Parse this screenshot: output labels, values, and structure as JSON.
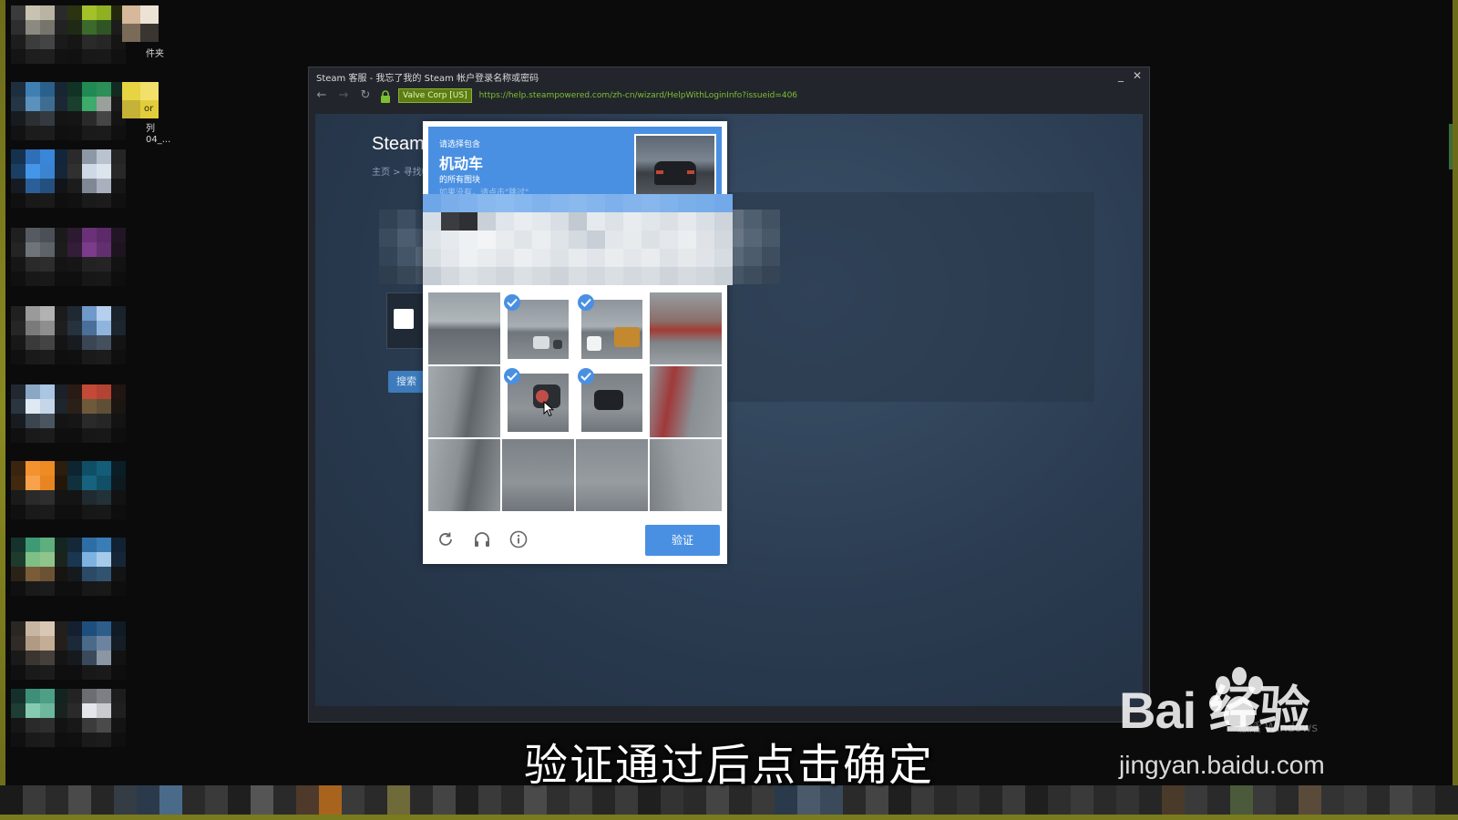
{
  "desktop": {
    "labels": [
      "件夹",
      "or",
      "列",
      "04_..."
    ]
  },
  "window": {
    "title": "Steam 客服 - 我忘了我的 Steam 帐户登录名称或密码",
    "minimize": "_",
    "close": "✕",
    "cert_badge": "Valve Corp [US]",
    "url": "https://help.steampowered.com/zh-cn/wizard/HelpWithLoginInfo?issueid=406"
  },
  "page": {
    "heading": "Steam",
    "breadcrumb": "主页 > 寻找帐",
    "search_button": "搜索"
  },
  "captcha": {
    "prompt_line1": "请选择包含",
    "prompt_target": "机动车",
    "prompt_line2": "的所有图块",
    "prompt_line3": "如果没有，请点击\"跳过\"",
    "verify_button": "验证",
    "tiles_selected": [
      1,
      2,
      5,
      6
    ]
  },
  "overlay": {
    "subtitle": "验证通过后点击确定",
    "watermark_logo": "Bai   经验",
    "watermark_url": "jingyan.baidu.com",
    "windows_hint": "激活 Windows"
  },
  "colors": {
    "hcaptcha_blue": "#4a90e2",
    "steam_bg": "#2a3b50",
    "cert_green": "#5c7e10",
    "url_green": "#7cbf32"
  }
}
